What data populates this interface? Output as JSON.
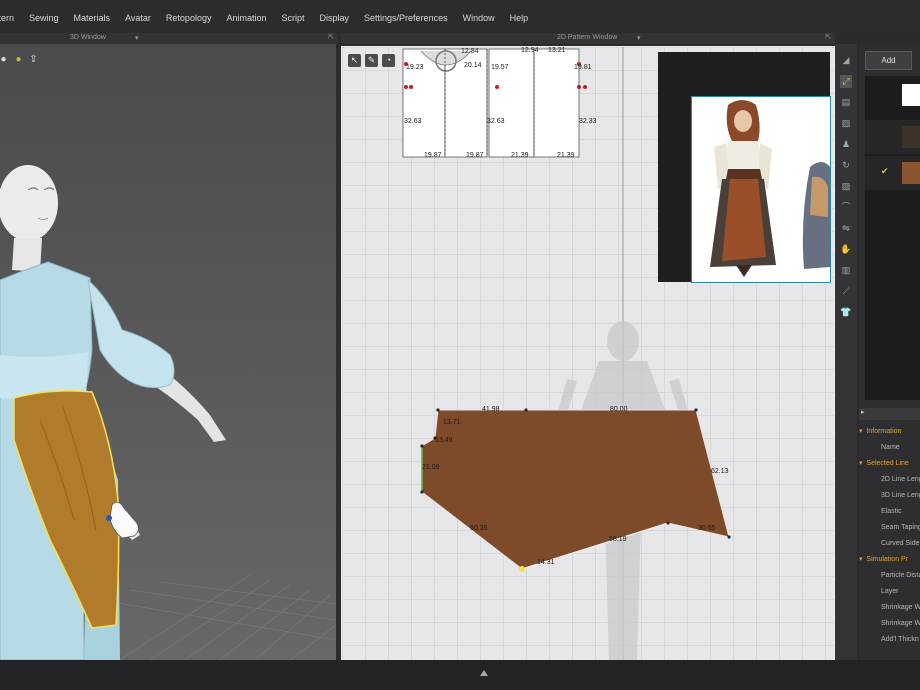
{
  "menu": [
    "ttern",
    "Sewing",
    "Materials",
    "Avatar",
    "Retopology",
    "Animation",
    "Script",
    "Display",
    "Settings/Preferences",
    "Window",
    "Help"
  ],
  "windows": {
    "w3d_title": "3D Window",
    "w2d_title": "2D Pattern Window"
  },
  "right_panel": {
    "add_label": "Add",
    "properties": [
      {
        "label": "Information",
        "type": "section"
      },
      {
        "label": "Name",
        "type": "item"
      },
      {
        "label": "Selected Line",
        "type": "section"
      },
      {
        "label": "2D Line Leng",
        "type": "item"
      },
      {
        "label": "3D Line Leng",
        "type": "item"
      },
      {
        "label": "Elastic",
        "type": "item"
      },
      {
        "label": "Seam Taping",
        "type": "item"
      },
      {
        "label": "Curved Side",
        "type": "item"
      },
      {
        "label": "Simulation Pr",
        "type": "section"
      },
      {
        "label": "Particle Dista",
        "type": "item"
      },
      {
        "label": "Layer",
        "type": "item"
      },
      {
        "label": "Shrinkage W",
        "type": "item"
      },
      {
        "label": "Shrinkage W",
        "type": "item"
      },
      {
        "label": "Add'l Thickn",
        "type": "item"
      }
    ],
    "colors": {
      "swatch1": "#ffffff",
      "swatch2": "#3d3228",
      "swatch3": "#8b5530"
    }
  },
  "pattern_labels": {
    "top_pieces": [
      "19.23",
      "20.14",
      "19.57",
      "19.81",
      "12.84",
      "12.94",
      "13.21",
      "32.63",
      "32.63",
      "32.33",
      "19.87",
      "19.87",
      "21.39",
      "21.39"
    ],
    "apron": [
      "41.98",
      "80.00",
      "13.71",
      "13.49",
      "21.09",
      "62.13",
      "60.35",
      "58.19",
      "30.55",
      "14.31"
    ]
  },
  "colors": {
    "apron_fill": "#7d4a2a",
    "apron_line": "#e0e0e0",
    "selected_seam": "#6fb04a",
    "garment": "#b8dde8",
    "apron3d": "#b5802e"
  }
}
